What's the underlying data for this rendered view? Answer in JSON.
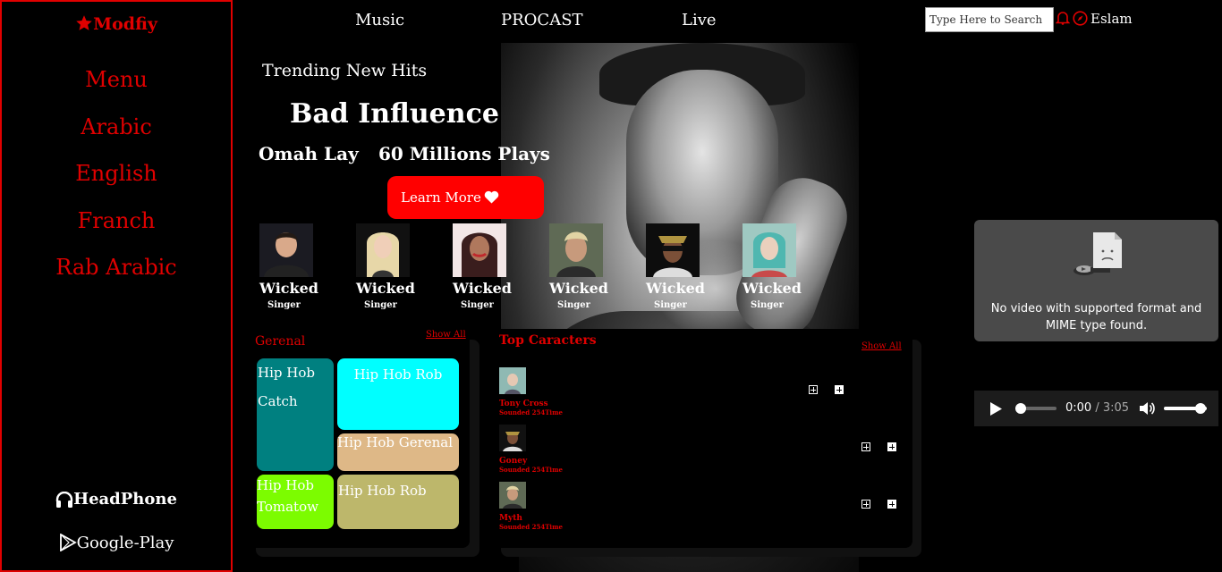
{
  "sidebar": {
    "brand": "Modfiy",
    "menu": [
      "Menu",
      "Arabic",
      "English",
      "Franch",
      "Rab Arabic"
    ],
    "headphone": "HeadPhone",
    "google_play": "Google-Play"
  },
  "nav": {
    "links": [
      "Music",
      "PROCAST",
      "Live"
    ],
    "search_placeholder": "Type Here to Search",
    "user": "Eslam"
  },
  "hero": {
    "kicker": "Trending New Hits",
    "song": "Bad Influence",
    "artist": "Omah Lay",
    "plays": "60 Millions Plays",
    "cta": "Learn More"
  },
  "singers": [
    {
      "name": "Wicked",
      "role": "Singer"
    },
    {
      "name": "Wicked",
      "role": "Singer"
    },
    {
      "name": "Wicked",
      "role": "Singer"
    },
    {
      "name": "Wicked",
      "role": "Singer"
    },
    {
      "name": "Wicked",
      "role": "Singer"
    },
    {
      "name": "Wicked",
      "role": "Singer"
    }
  ],
  "general": {
    "title": "Gerenal",
    "show_all": "Show All",
    "tiles": [
      {
        "line1": "Hip Hob",
        "line2": "Catch",
        "color": "#008080"
      },
      {
        "line1": "Hip Hob Rob",
        "color": "#00ffff"
      },
      {
        "line1": "Hip Hob Gerenal",
        "color": "#deb887"
      },
      {
        "line1": "Hip Hob",
        "line2": "Tomatow",
        "color": "#7cfc00"
      },
      {
        "line1": "Hip Hob Rob",
        "color": "#bdb76b"
      }
    ]
  },
  "top_characters": {
    "title": "Top Caracters",
    "show_all": "Show All",
    "items": [
      {
        "name": "Tony Cross",
        "sub": "Sounded 254Time"
      },
      {
        "name": "Goney",
        "sub": "Sounded 254Time"
      },
      {
        "name": "Myth",
        "sub": "Sounded 254Time"
      }
    ]
  },
  "video": {
    "message_line1": "No video with supported format and",
    "message_line2": "MIME type found."
  },
  "audio": {
    "current": "0:00",
    "duration": "3:05",
    "progress": 0,
    "volume": 1
  },
  "colors": {
    "accent": "#e00000",
    "button": "#ff0000"
  }
}
